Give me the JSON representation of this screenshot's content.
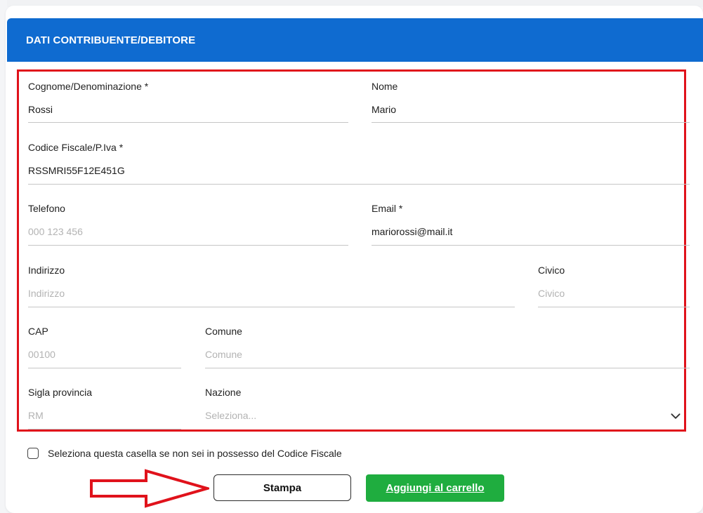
{
  "section": {
    "title": "DATI CONTRIBUENTE/DEBITORE"
  },
  "fields": {
    "cognome": {
      "label": "Cognome/Denominazione *",
      "value": "Rossi"
    },
    "nome": {
      "label": "Nome",
      "value": "Mario"
    },
    "codice_fiscale": {
      "label": "Codice Fiscale/P.Iva *",
      "value": "RSSMRI55F12E451G"
    },
    "telefono": {
      "label": "Telefono",
      "placeholder": "000 123 456"
    },
    "email": {
      "label": "Email *",
      "value": "mariorossi@mail.it"
    },
    "indirizzo": {
      "label": "Indirizzo",
      "placeholder": "Indirizzo"
    },
    "civico": {
      "label": "Civico",
      "placeholder": "Civico"
    },
    "cap": {
      "label": "CAP",
      "placeholder": "00100"
    },
    "comune": {
      "label": "Comune",
      "placeholder": "Comune"
    },
    "sigla_provincia": {
      "label": "Sigla provincia",
      "placeholder": "RM"
    },
    "nazione": {
      "label": "Nazione",
      "placeholder": "Seleziona..."
    }
  },
  "checkbox": {
    "label": "Seleziona questa casella se non sei in possesso del Codice Fiscale",
    "checked": false
  },
  "buttons": {
    "stampa": "Stampa",
    "aggiungi": "Aggiungi al carrello"
  },
  "colors": {
    "header": "#0f6bd0",
    "highlight": "#e0121b",
    "primary_button": "#1fad3f"
  },
  "icons": {
    "select": "chevron-down-icon",
    "annotation": "arrow-right-outline-icon"
  }
}
